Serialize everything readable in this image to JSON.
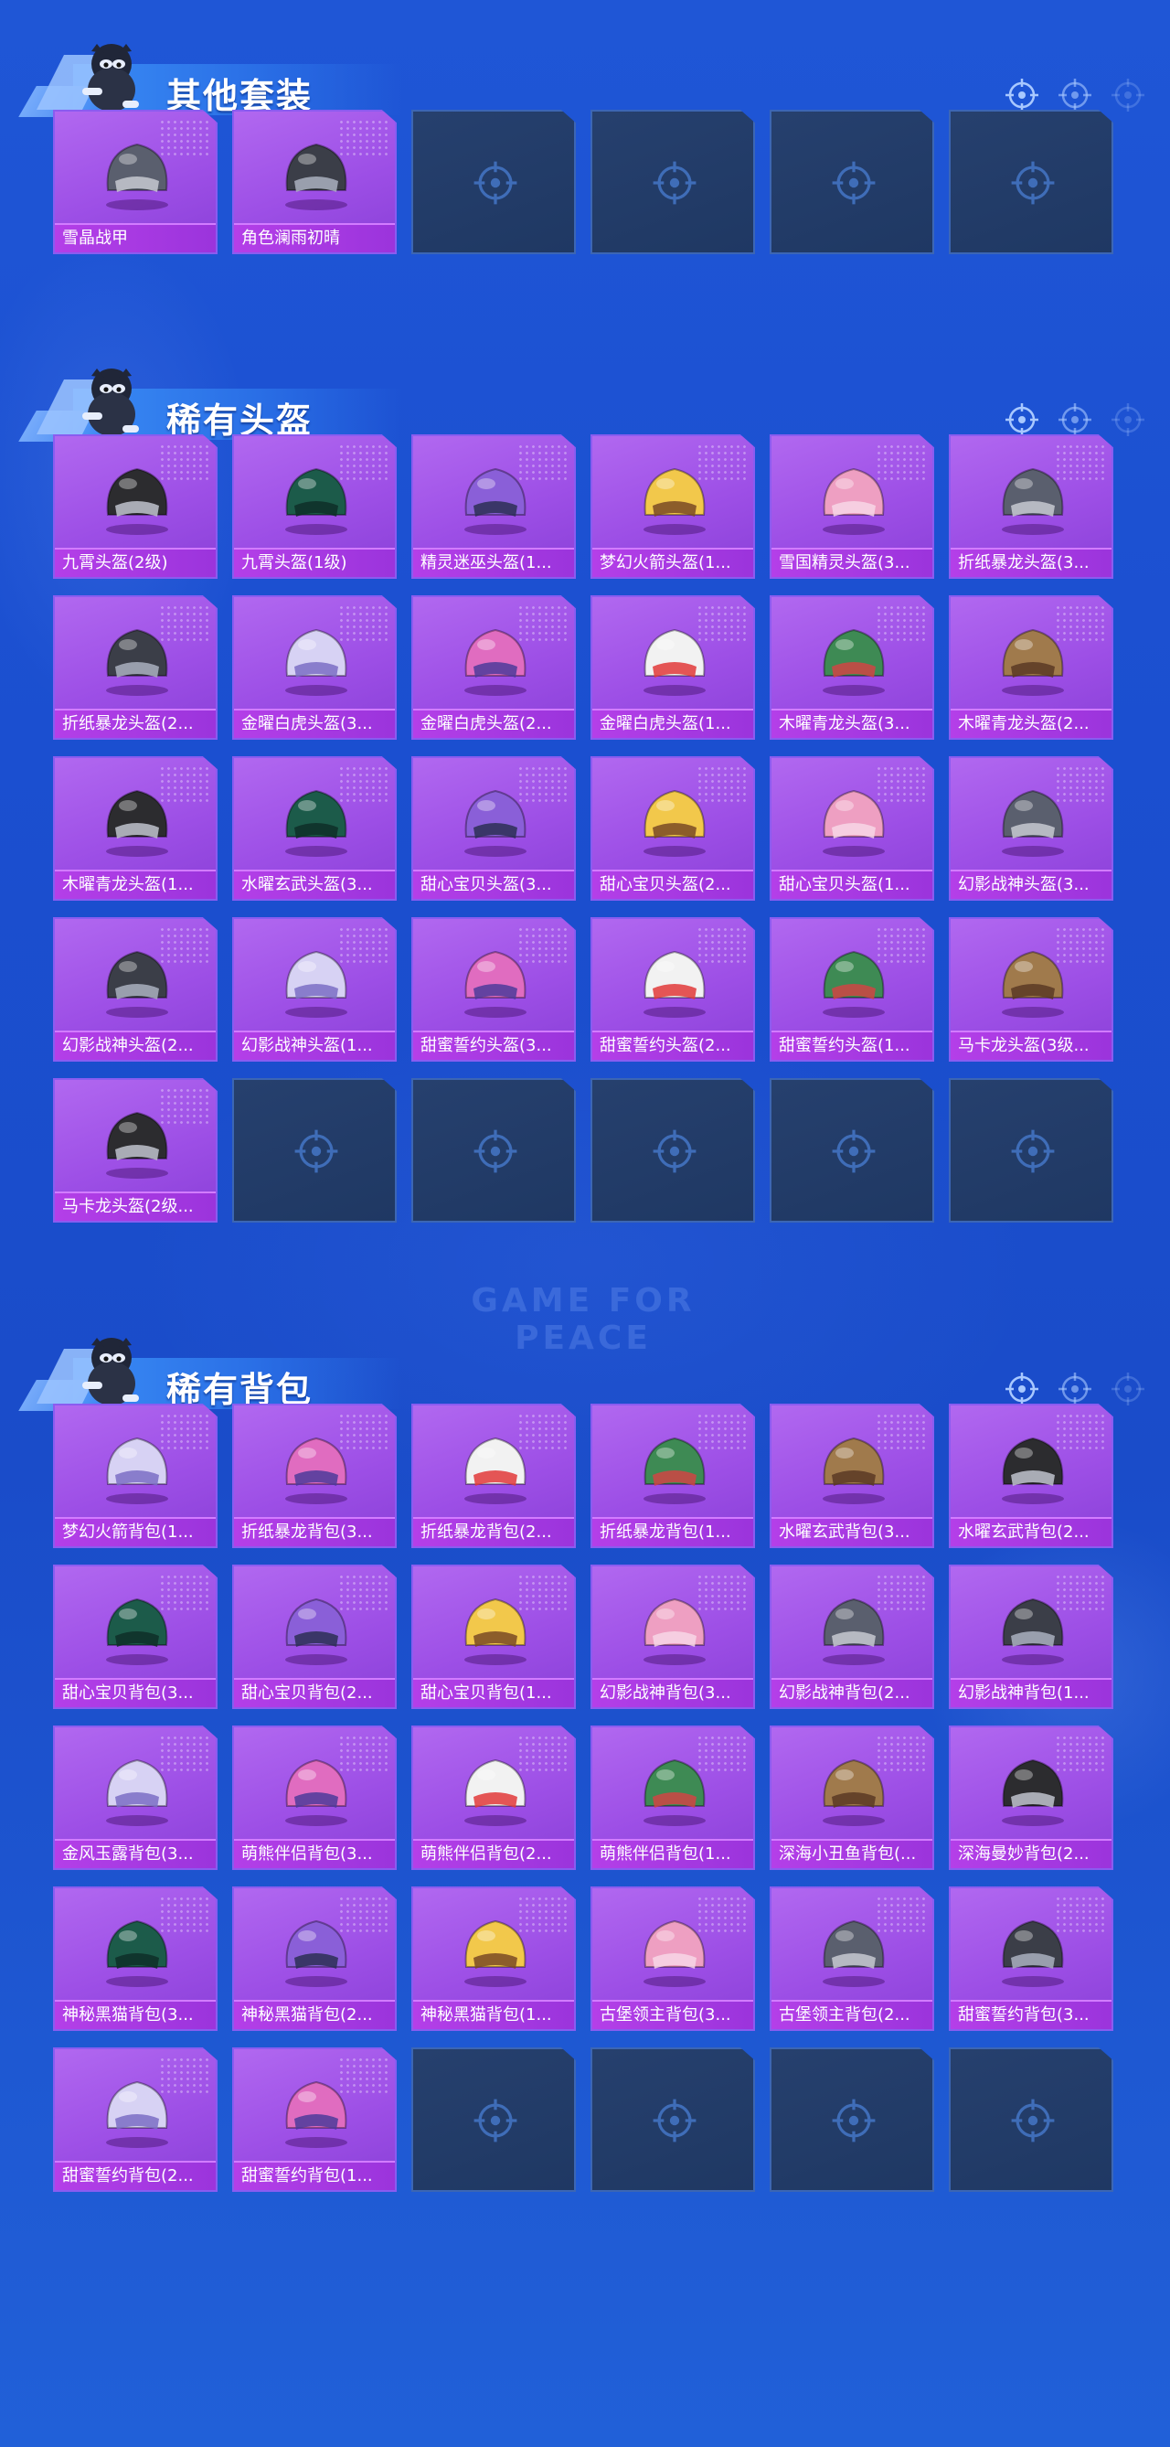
{
  "colors": {
    "background": "#1f56d6",
    "tile_filled": "#a55cec",
    "tile_label": "#b43fe8",
    "tile_empty": "#233c69"
  },
  "watermark": "GAME FOR PEACE",
  "sections": [
    {
      "title": "其他套装",
      "items": [
        "雪晶战甲",
        "角色澜雨初晴"
      ],
      "empty_slots": 4
    },
    {
      "title": "稀有头盔",
      "items": [
        "九霄头盔(2级)",
        "九霄头盔(1级)",
        "精灵迷巫头盔(1...",
        "梦幻火箭头盔(1...",
        "雪国精灵头盔(3...",
        "折纸暴龙头盔(3...",
        "折纸暴龙头盔(2...",
        "金曜白虎头盔(3...",
        "金曜白虎头盔(2...",
        "金曜白虎头盔(1...",
        "木曜青龙头盔(3...",
        "木曜青龙头盔(2...",
        "木曜青龙头盔(1...",
        "水曜玄武头盔(3...",
        "甜心宝贝头盔(3...",
        "甜心宝贝头盔(2...",
        "甜心宝贝头盔(1...",
        "幻影战神头盔(3...",
        "幻影战神头盔(2...",
        "幻影战神头盔(1...",
        "甜蜜誓约头盔(3...",
        "甜蜜誓约头盔(2...",
        "甜蜜誓约头盔(1...",
        "马卡龙头盔(3级...",
        "马卡龙头盔(2级..."
      ],
      "empty_slots": 5
    },
    {
      "title": "稀有背包",
      "items": [
        "梦幻火箭背包(1...",
        "折纸暴龙背包(3...",
        "折纸暴龙背包(2...",
        "折纸暴龙背包(1...",
        "水曜玄武背包(3...",
        "水曜玄武背包(2...",
        "甜心宝贝背包(3...",
        "甜心宝贝背包(2...",
        "甜心宝贝背包(1...",
        "幻影战神背包(3...",
        "幻影战神背包(2...",
        "幻影战神背包(1...",
        "金风玉露背包(3...",
        "萌熊伴侣背包(3...",
        "萌熊伴侣背包(2...",
        "萌熊伴侣背包(1...",
        "深海小丑鱼背包(...",
        "深海曼妙背包(2...",
        "神秘黑猫背包(3...",
        "神秘黑猫背包(2...",
        "神秘黑猫背包(1...",
        "古堡领主背包(3...",
        "古堡领主背包(2...",
        "甜蜜誓约背包(3...",
        "甜蜜誓约背包(2...",
        "甜蜜誓约背包(1..."
      ],
      "empty_slots": 4
    }
  ]
}
